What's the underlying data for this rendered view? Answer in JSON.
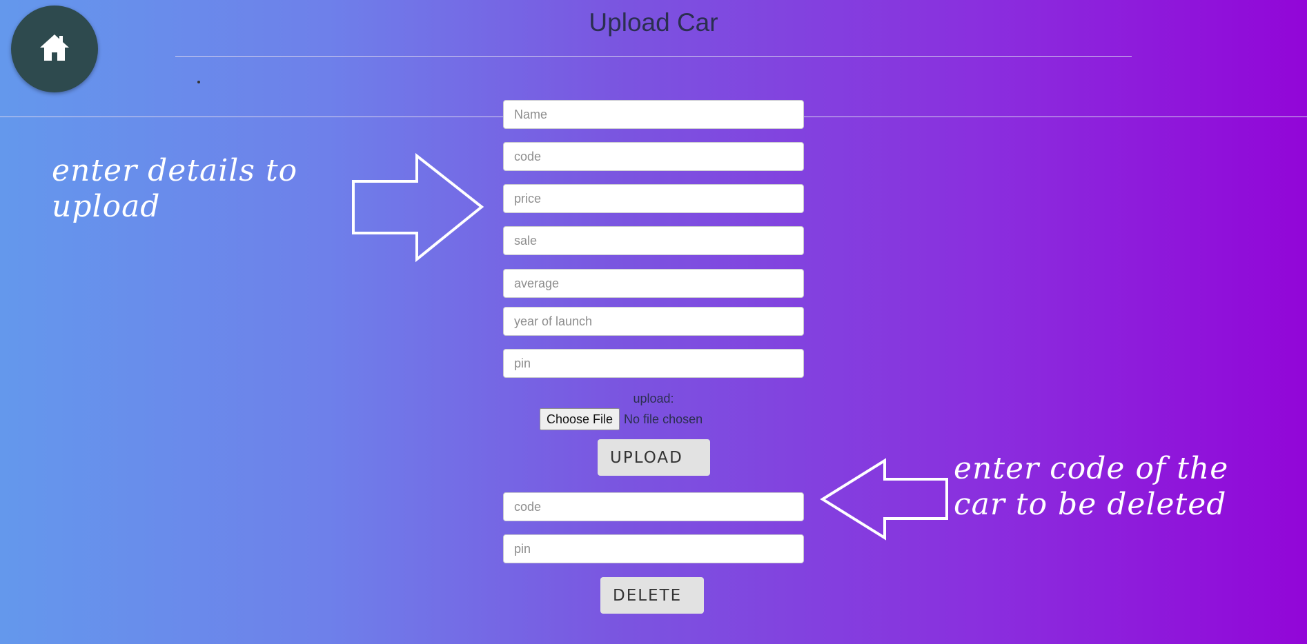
{
  "header": {
    "title": "Upload Car",
    "home_icon": "home-icon",
    "dot": "."
  },
  "upload_form": {
    "fields": [
      {
        "placeholder": "Name",
        "value": ""
      },
      {
        "placeholder": "code",
        "value": ""
      },
      {
        "placeholder": "price",
        "value": ""
      },
      {
        "placeholder": "sale",
        "value": ""
      },
      {
        "placeholder": "average",
        "value": ""
      },
      {
        "placeholder": "year of launch",
        "value": ""
      },
      {
        "placeholder": "pin",
        "value": ""
      }
    ],
    "upload_label": "upload:",
    "file_button_label": "Choose File",
    "file_status": "No file chosen",
    "submit_label": "UPLOAD"
  },
  "delete_form": {
    "fields": [
      {
        "placeholder": "code",
        "value": ""
      },
      {
        "placeholder": "pin",
        "value": ""
      }
    ],
    "submit_label": "DELETE"
  },
  "annotations": {
    "upload_hint": [
      "enter details to",
      "upload"
    ],
    "delete_hint": [
      "enter code of the",
      "car to be deleted"
    ],
    "upload_arrow_icon": "arrow-right-icon",
    "delete_arrow_icon": "arrow-left-icon"
  },
  "colors": {
    "gradient_start": "#6498ec",
    "gradient_end": "#9206d8",
    "home_button": "#2e4a4e",
    "button_bg": "#e2e2e2"
  }
}
